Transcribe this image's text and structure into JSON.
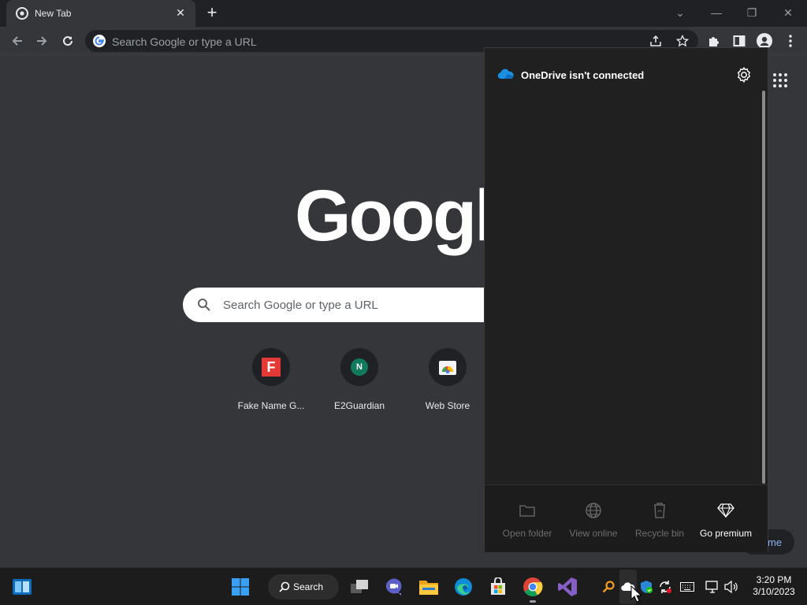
{
  "browser": {
    "tab_title": "New Tab",
    "omnibox_placeholder": "Search Google or type a URL"
  },
  "newtab": {
    "logo_text": "Google",
    "search_placeholder": "Search Google or type a URL",
    "shortcuts": [
      {
        "label": "Fake Name G...",
        "icon_letter": "F",
        "color": "#e53935"
      },
      {
        "label": "E2Guardian",
        "icon_letter": "N",
        "color": "#0f7b5c"
      },
      {
        "label": "Web Store",
        "icon_letter": "",
        "color": "#ffffff"
      }
    ],
    "customize_partial": "me"
  },
  "onedrive": {
    "title": "OneDrive isn't connected",
    "actions": [
      {
        "label": "Open folder",
        "icon": "folder-icon",
        "enabled": false
      },
      {
        "label": "View online",
        "icon": "globe-icon",
        "enabled": false
      },
      {
        "label": "Recycle bin",
        "icon": "recycle-bin-icon",
        "enabled": false
      },
      {
        "label": "Go premium",
        "icon": "diamond-icon",
        "enabled": true
      }
    ]
  },
  "taskbar": {
    "search_label": "Search",
    "time": "3:20 PM",
    "date": "3/10/2023"
  },
  "colors": {
    "chrome_dark": "#202124",
    "chrome_toolbar": "#35363a",
    "onedrive_blue": "#0f6cbd",
    "accent_link": "#8ab4f8"
  }
}
